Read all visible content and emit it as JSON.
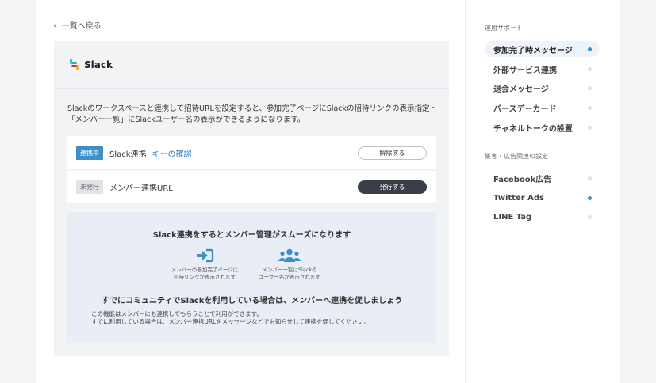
{
  "back_link": "一覧へ戻る",
  "card": {
    "service_name": "Slack",
    "description": "Slackのワークスペースと連携して招待URLを設定すると、参加完了ページにSlackの招待リンクの表示指定・「メンバー一覧」にSlackユーザー名の表示ができるようになります。",
    "row1": {
      "tag": "連携中",
      "label": "Slack連携",
      "link": "キーの確認",
      "button": "解除する"
    },
    "row2": {
      "tag": "未発行",
      "label": "メンバー連携URL",
      "button": "発行する"
    }
  },
  "info": {
    "title": "Slack連携をするとメンバー管理がスムーズになります",
    "feature1": "メンバーの参加完了ページに\n招待リンクが表示されます",
    "feature2": "メンバー一覧にSlackの\nユーザー名が表示されます",
    "subtitle": "すでにコミュニティでSlackを利用している場合は、メンバーへ連携を促しましょう",
    "note1": "この機能はメンバーにも連携してもらうことで利用ができます。",
    "note2": "すでに利用している場合は、メンバー連携URLをメッセージなどでお知らせして連携を促してください。"
  },
  "sidebar": {
    "section1": "運用サポート",
    "items1": [
      "参加完了時メッセージ",
      "外部サービス連携",
      "退会メッセージ",
      "バースデーカード",
      "チャネルトークの設置"
    ],
    "section2": "集客・広告関連の設定",
    "items2": [
      "Facebook広告",
      "Twitter Ads",
      "LINE Tag"
    ]
  },
  "colors": {
    "accent": "#3f8fc6",
    "dark_button": "#3a3f47",
    "info_bg": "#e9eef6"
  }
}
